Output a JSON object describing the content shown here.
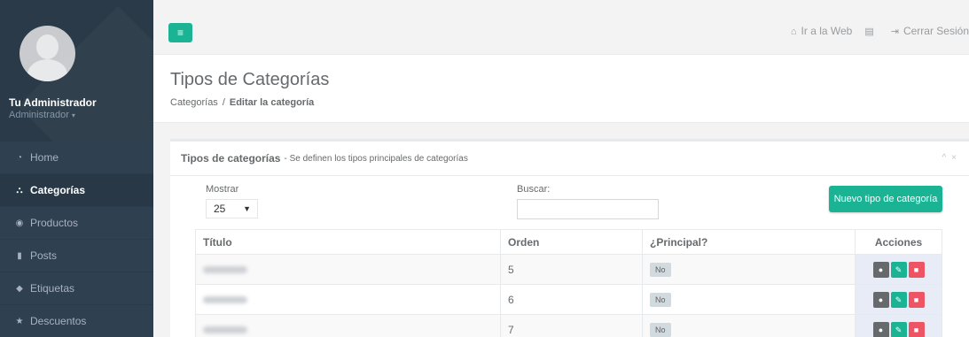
{
  "sidebar": {
    "user_name": "Tu Administrador",
    "user_role": "Administrador",
    "items": [
      {
        "icon": "dashboard-icon",
        "glyph": "◔",
        "label": "Home"
      },
      {
        "icon": "sitemap-icon",
        "glyph": "⛬",
        "label": "Categorías"
      },
      {
        "icon": "globe-icon",
        "glyph": "◉",
        "label": "Productos"
      },
      {
        "icon": "files-icon",
        "glyph": "▮",
        "label": "Posts"
      },
      {
        "icon": "tag-icon",
        "glyph": "◆",
        "label": "Etiquetas"
      },
      {
        "icon": "star-icon",
        "glyph": "★",
        "label": "Descuentos"
      }
    ],
    "active_index": 1
  },
  "topbar": {
    "menu_glyph": "≡",
    "go_web_label": "Ir a la Web",
    "go_web_glyph": "⌂",
    "messages_glyph": "▤",
    "logout_label": "Cerrar Sesión",
    "logout_glyph": "⇥"
  },
  "header": {
    "title": "Tipos de Categorías",
    "breadcrumb_parent": "Categorías",
    "breadcrumb_separator": "/",
    "breadcrumb_current": "Editar la categoría"
  },
  "panel": {
    "title": "Tipos de categorías",
    "subtitle": "- Se definen los tipos principales de categorías",
    "collapse_glyph": "^",
    "close_glyph": "×",
    "show_label": "Mostrar",
    "show_value": "25",
    "search_label": "Buscar:",
    "search_value": "",
    "new_button": "Nuevo tipo de categoría",
    "columns": [
      "Título",
      "Orden",
      "¿Principal?",
      "Acciones"
    ],
    "rows": [
      {
        "order": "5",
        "principal": "No"
      },
      {
        "order": "6",
        "principal": "No"
      },
      {
        "order": "7",
        "principal": "No"
      }
    ],
    "action_glyphs": {
      "view": "●",
      "edit": "✎",
      "delete": "■"
    }
  },
  "colors": {
    "sidebar_bg": "#2f4050",
    "accent": "#1ab394",
    "danger": "#ed5565",
    "neutral_button": "#676a6c"
  }
}
